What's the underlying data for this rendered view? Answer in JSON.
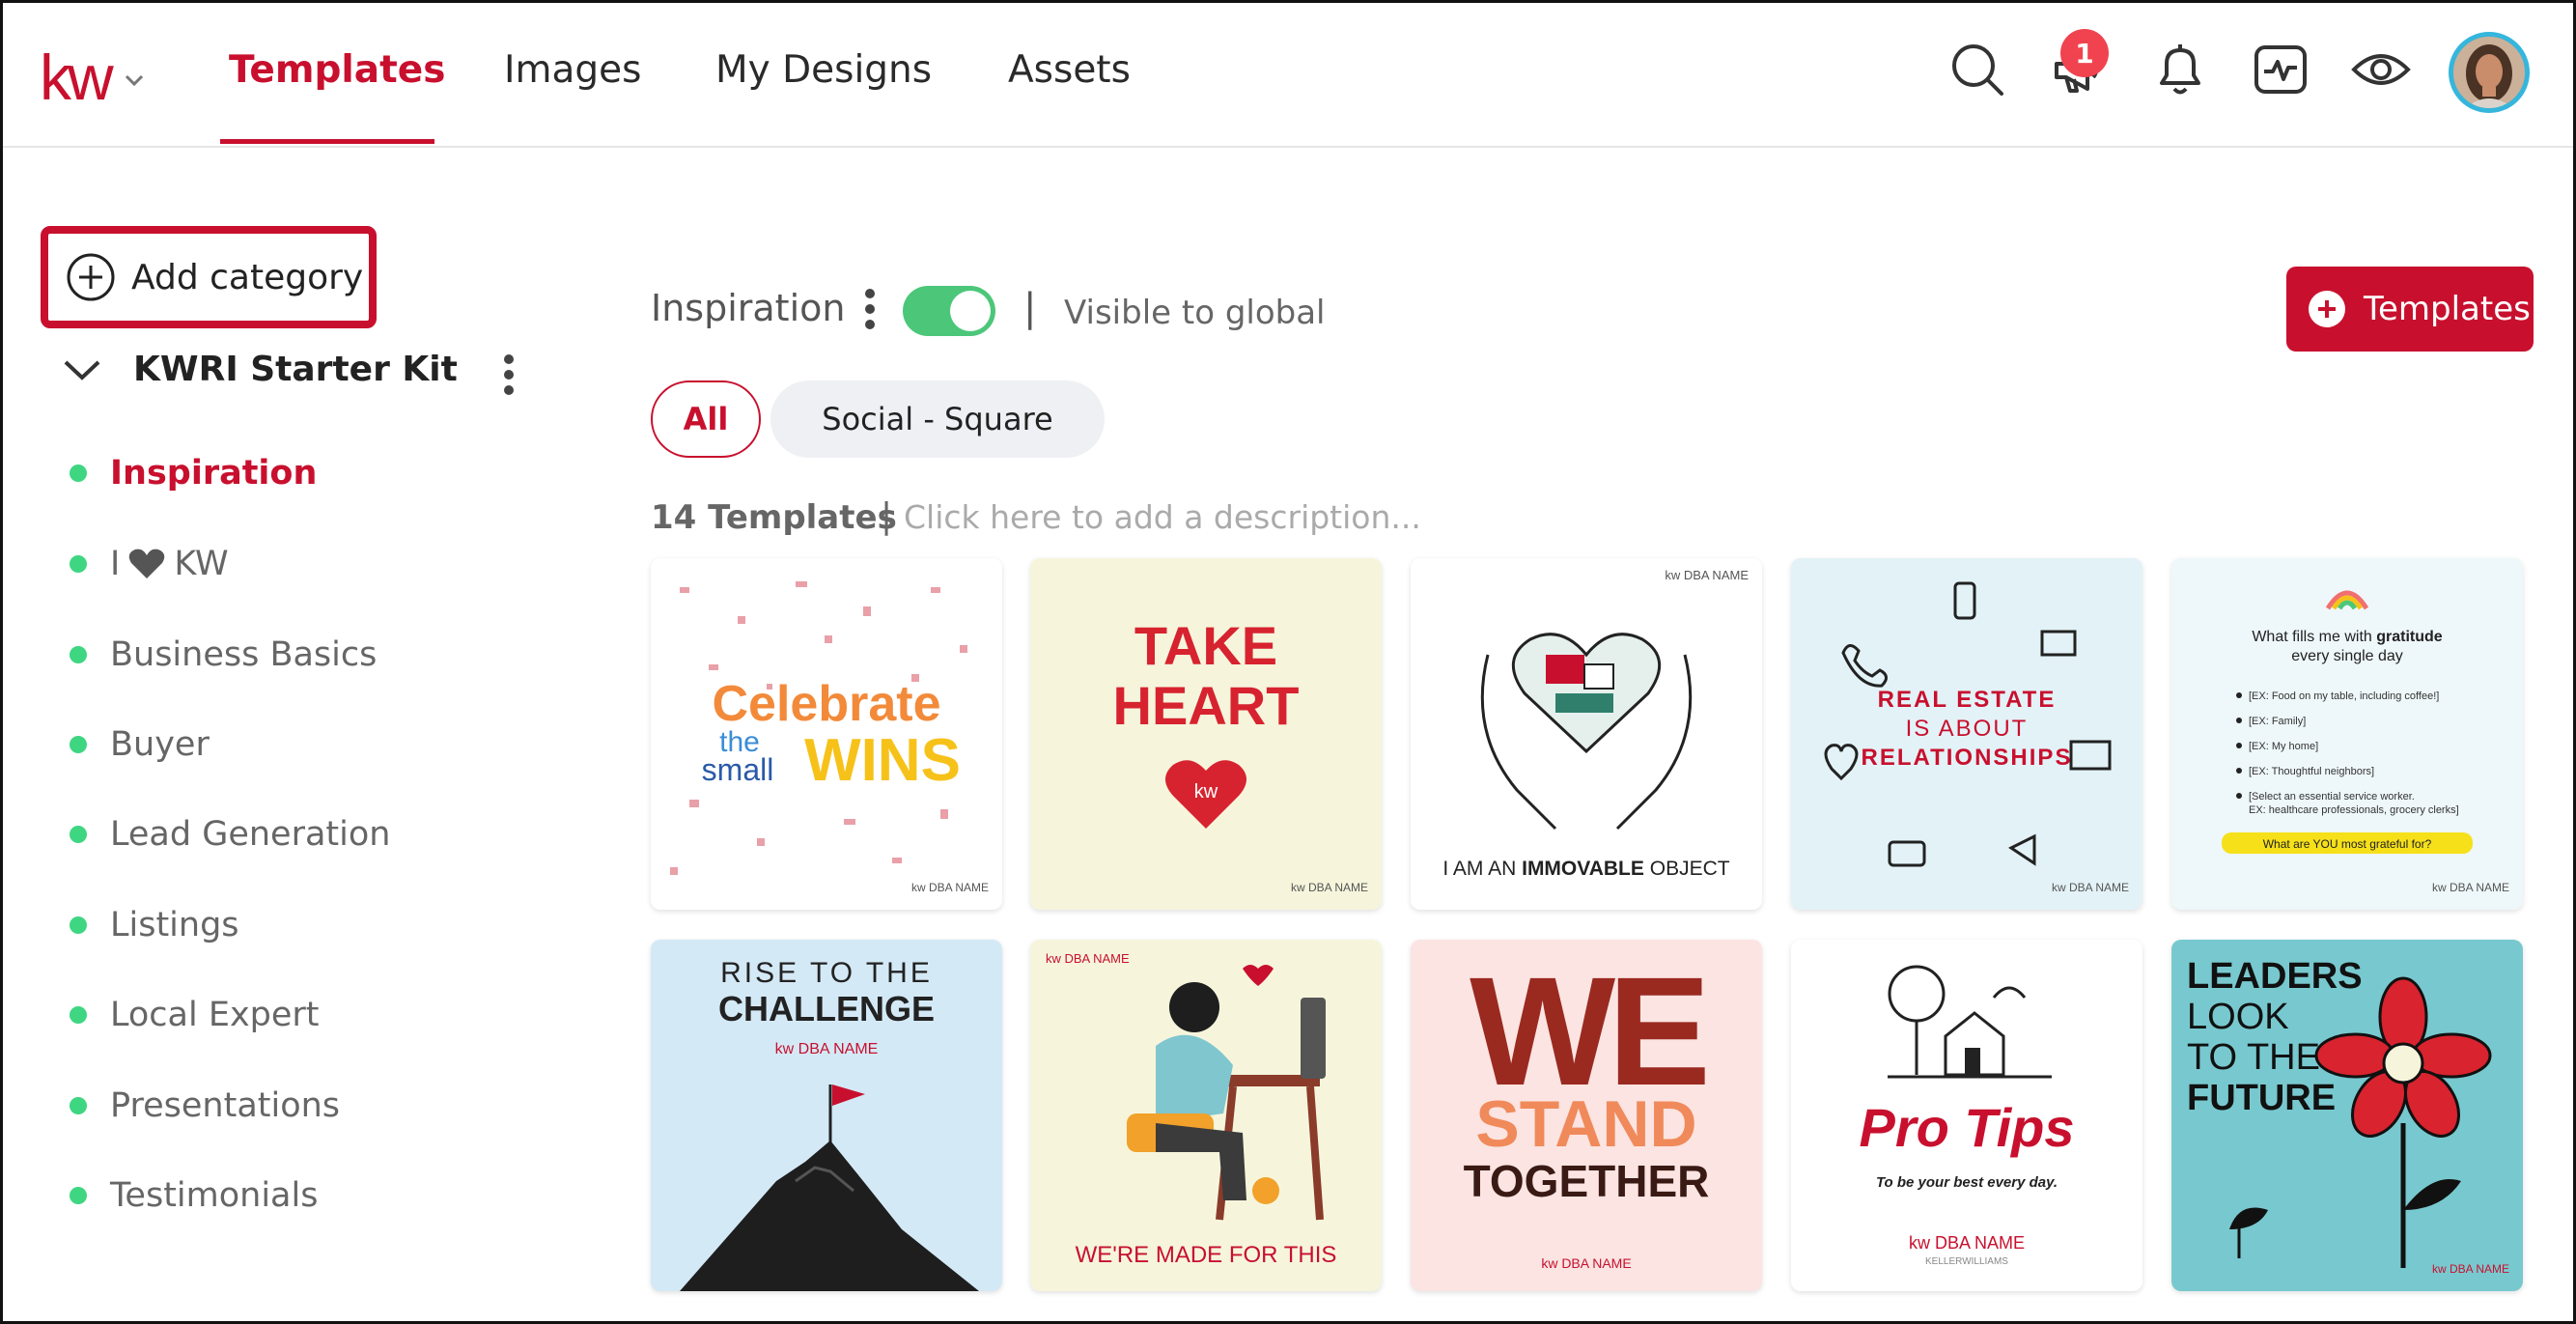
{
  "header": {
    "logo_text": "kw",
    "tabs": [
      {
        "label": "Templates",
        "active": true
      },
      {
        "label": "Images"
      },
      {
        "label": "My Designs"
      },
      {
        "label": "Assets"
      }
    ],
    "icons": [
      "search-icon",
      "megaphone-icon",
      "bell-icon",
      "activity-icon",
      "eye-icon"
    ],
    "announcement_badge": "1",
    "accent_color": "#c8102e"
  },
  "sidebar": {
    "add_category_label": "Add category",
    "kit_title": "KWRI Starter Kit",
    "items": [
      {
        "label": "Inspiration",
        "active": true
      },
      {
        "label": "I",
        "suffix": "KW",
        "heart": true
      },
      {
        "label": "Business Basics"
      },
      {
        "label": "Buyer"
      },
      {
        "label": "Lead Generation"
      },
      {
        "label": "Listings"
      },
      {
        "label": "Local Expert"
      },
      {
        "label": "Presentations"
      },
      {
        "label": "Testimonials"
      }
    ]
  },
  "main": {
    "category_title": "Inspiration",
    "visibility_toggle_on": true,
    "separator": "|",
    "visibility_label": "Visible to global",
    "add_templates_label": "Templates",
    "filters": [
      {
        "label": "All",
        "selected": true
      },
      {
        "label": "Social - Square"
      }
    ],
    "count_label": "14 Templates",
    "count_separator": "|",
    "description_placeholder": "Click here to add a description...",
    "templates": [
      {
        "lines": [
          "Celebrate",
          "the",
          "small",
          "WINS"
        ],
        "footer": "kw DBA NAME"
      },
      {
        "lines": [
          "TAKE",
          "HEART",
          "kw"
        ],
        "footer": "kw DBA NAME"
      },
      {
        "lines": [
          "I AM AN",
          "IMMOVABLE",
          "OBJECT"
        ],
        "header": "kw DBA NAME"
      },
      {
        "lines": [
          "REAL ESTATE",
          "IS ABOUT",
          "RELATIONSHIPS"
        ],
        "footer": "kw DBA NAME"
      },
      {
        "lines": [
          "What fills me with",
          "gratitude",
          "every single day",
          "[EX: Food on my table, including coffee!]",
          "[EX: Family]",
          "[EX: My home]",
          "[EX: Thoughtful neighbors]",
          "[Select an essential service worker.",
          "EX: healthcare professionals, grocery clerks]",
          "What are YOU most grateful for?"
        ],
        "footer": "kw DBA NAME"
      },
      {
        "lines": [
          "RISE TO THE",
          "CHALLENGE",
          "kw DBA NAME"
        ]
      },
      {
        "lines": [
          "kw DBA NAME",
          "WE'RE MADE FOR THIS"
        ]
      },
      {
        "lines": [
          "WE",
          "STAND",
          "TOGETHER"
        ],
        "footer": "kw DBA NAME"
      },
      {
        "lines": [
          "Pro Tips",
          "To be your best every day.",
          "kw DBA NAME",
          "KELLERWILLIAMS"
        ]
      },
      {
        "lines": [
          "LEADERS",
          "LOOK",
          "TO THE",
          "FUTURE"
        ],
        "footer": "kw DBA NAME"
      }
    ]
  }
}
